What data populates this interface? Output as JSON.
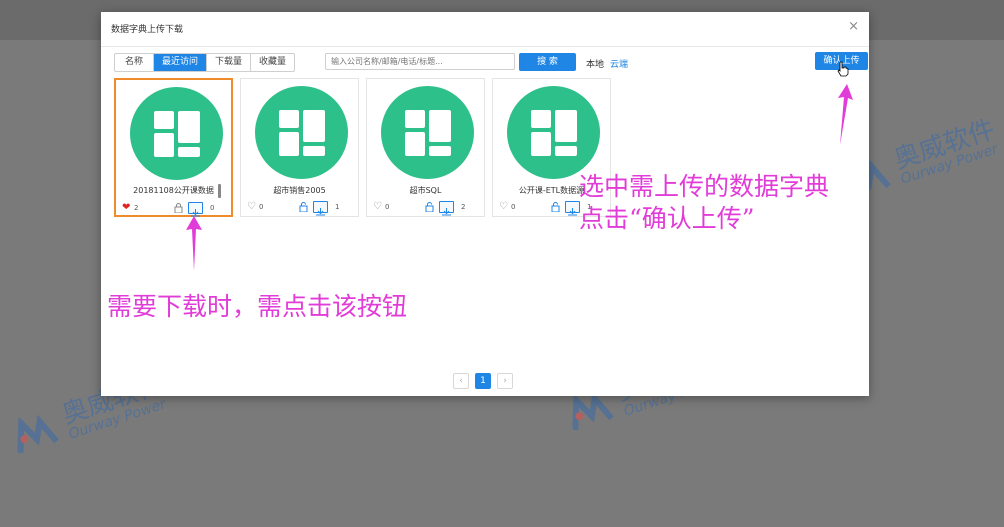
{
  "modal": {
    "title": "数据字典上传下载",
    "close": "×"
  },
  "toolbar": {
    "tabs": [
      "名称",
      "最近访问",
      "下载量",
      "收藏量"
    ],
    "active_tab": 1,
    "search_placeholder": "输入公司名称/邮箱/电话/标题...",
    "search_label": "搜 索",
    "source_local": "本地",
    "source_cloud": "云端",
    "confirm_label": "确认上传"
  },
  "cards": [
    {
      "name": "20181108公开课数据",
      "favorites": "2",
      "downloads": "0",
      "favorited": true,
      "selected": true
    },
    {
      "name": "超市销售2005",
      "favorites": "0",
      "downloads": "1",
      "favorited": false,
      "selected": false
    },
    {
      "name": "超市SQL",
      "favorites": "0",
      "downloads": "2",
      "favorited": false,
      "selected": false
    },
    {
      "name": "公开课-ETL数据源",
      "favorites": "0",
      "downloads": "1",
      "favorited": false,
      "selected": false
    }
  ],
  "pagination": {
    "prev": "‹",
    "current": "1",
    "next": "›"
  },
  "annotations": {
    "download_hint": "需要下载时，需点击该按钮",
    "upload_hint_line1": "选中需上传的数据字典",
    "upload_hint_line2": "点击“确认上传”"
  },
  "watermark": {
    "brand_cn": "奥威软件",
    "brand_en": "Ourway Power"
  },
  "colors": {
    "accent": "#1f86e6",
    "thumb": "#2ec08a",
    "selected_border": "#f08b2c",
    "annotation": "#e23cd8"
  }
}
